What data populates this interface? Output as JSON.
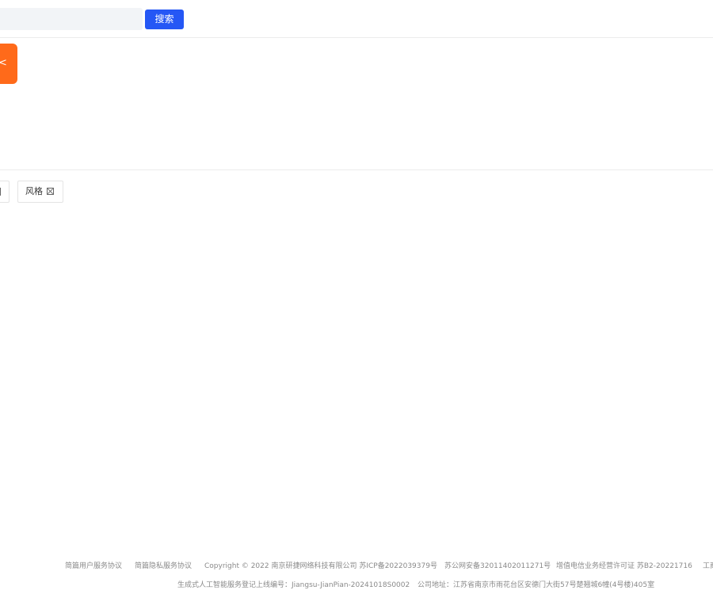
{
  "header": {
    "search_placeholder": "",
    "search_button_label": "搜索"
  },
  "side_tab": {
    "glyph": "<"
  },
  "tags": {
    "style_label": "风格"
  },
  "footer": {
    "user_agreement": "简篇用户服务协议",
    "privacy_agreement": "简篇隐私服务协议",
    "copyright": "Copyright © 2022 南京研捷网络科技有限公司 苏ICP备2022039379号",
    "police_record": "苏公网安备32011402011271号",
    "telecom_license": "增值电信业务经营许可证 苏B2-20221716",
    "truncated_item": "工商",
    "ai_registration": "生成式人工智能服务登记上线编号：Jiangsu-JianPian-20241018S0002",
    "address": "公司地址：江苏省南京市雨花台区安德门大街57号楚翘城6幢(4号楼)405室"
  },
  "colors": {
    "primary_blue": "#2557f5",
    "accent_orange": "#ff6a1a",
    "footer_text": "#8a8a8a"
  }
}
